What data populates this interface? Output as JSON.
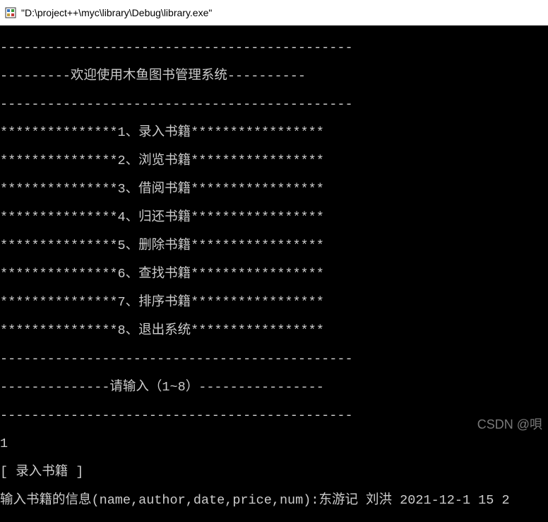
{
  "window": {
    "title": "\"D:\\project++\\myc\\library\\Debug\\library.exe\""
  },
  "console": {
    "lines": [
      "---------------------------------------------",
      "---------欢迎使用木鱼图书管理系统----------",
      "---------------------------------------------",
      "***************1、录入书籍*****************",
      "***************2、浏览书籍*****************",
      "***************3、借阅书籍*****************",
      "***************4、归还书籍*****************",
      "***************5、删除书籍*****************",
      "***************6、查找书籍*****************",
      "***************7、排序书籍*****************",
      "***************8、退出系统*****************",
      "---------------------------------------------",
      "--------------请输入（1~8）----------------",
      "---------------------------------------------",
      "1",
      "[ 录入书籍 ]",
      "输入书籍的信息(name,author,date,price,num):东游记 刘洪 2021-12-1 15 2"
    ]
  },
  "watermark": "CSDN @唄"
}
